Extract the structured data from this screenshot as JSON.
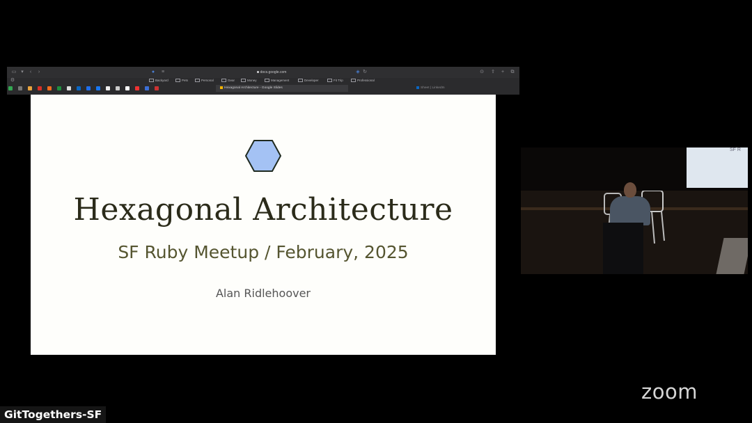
{
  "browser": {
    "url": "docs.google.com",
    "bookmarks": [
      "Backyard",
      "Pets",
      "Personal",
      "Gear",
      "Money",
      "Management",
      "Developer",
      "Fit Trip",
      "Professional"
    ],
    "active_tab": "Hexagonal Architecture - Google Slides",
    "second_tab": "Sheet | LinkedIn"
  },
  "slide": {
    "title": "Hexagonal Architecture",
    "subtitle": "SF Ruby Meetup / February, 2025",
    "author": "Alan Ridlehoover",
    "hex_fill": "#a4c2f4",
    "hex_stroke": "#1f2a1f"
  },
  "video": {
    "screen_text": "SF R"
  },
  "overlay": {
    "zoom_logo": "zoom",
    "participant_name": "GitTogethers-SF"
  }
}
